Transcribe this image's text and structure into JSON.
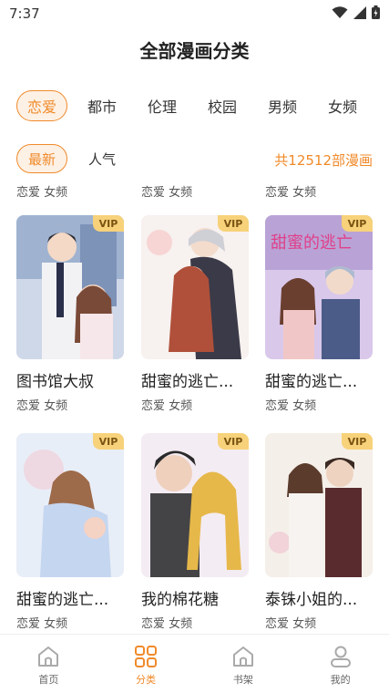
{
  "status_bar": {
    "time": "7:37"
  },
  "page_title": "全部漫画分类",
  "category_tabs": [
    {
      "label": "恋爱",
      "active": true
    },
    {
      "label": "都市",
      "active": false
    },
    {
      "label": "伦理",
      "active": false
    },
    {
      "label": "校园",
      "active": false
    },
    {
      "label": "男频",
      "active": false
    },
    {
      "label": "女频",
      "active": false
    }
  ],
  "sort_tabs": [
    {
      "label": "最新",
      "active": true
    },
    {
      "label": "人气",
      "active": false
    }
  ],
  "total_count": "共12512部漫画",
  "partial_row_tags": [
    "恋爱 女频",
    "恋爱 女频",
    "恋爱 女频"
  ],
  "comics": [
    {
      "title": "图书馆大叔",
      "tags": "恋爱 女频",
      "vip": "VIP"
    },
    {
      "title": "甜蜜的逃亡...",
      "tags": "恋爱 女频",
      "vip": "VIP"
    },
    {
      "title": "甜蜜的逃亡...",
      "tags": "恋爱 女频",
      "vip": "VIP"
    },
    {
      "title": "甜蜜的逃亡...",
      "tags": "恋爱 女频",
      "vip": "VIP"
    },
    {
      "title": "我的棉花糖",
      "tags": "恋爱 女频",
      "vip": "VIP"
    },
    {
      "title": "泰铢小姐的...",
      "tags": "恋爱 女频",
      "vip": "VIP"
    }
  ],
  "cover3_text": "甜蜜的逃亡",
  "bottom_nav": [
    {
      "label": "首页",
      "icon": "home-icon",
      "active": false
    },
    {
      "label": "分类",
      "icon": "category-grid-icon",
      "active": true
    },
    {
      "label": "书架",
      "icon": "bookshelf-icon",
      "active": false
    },
    {
      "label": "我的",
      "icon": "profile-icon",
      "active": false
    }
  ],
  "colors": {
    "accent": "#f08a2a",
    "vip_badge": "#f7d27a"
  }
}
